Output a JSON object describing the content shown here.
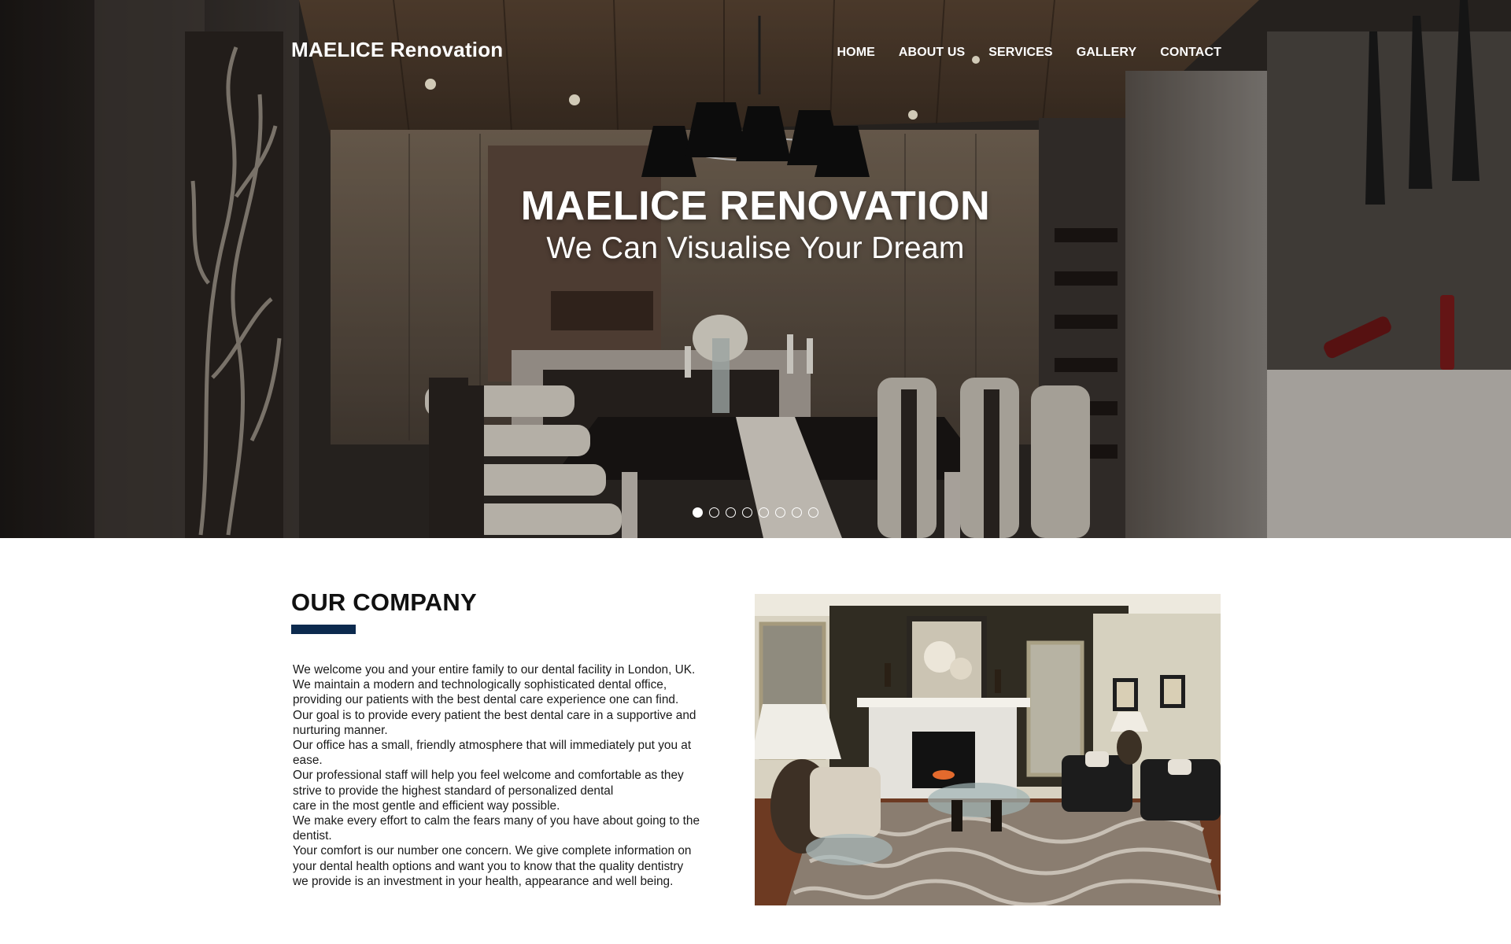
{
  "brand": "MAELICE Renovation",
  "nav": [
    "HOME",
    "ABOUT US",
    "SERVICES",
    "GALLERY",
    "CONTACT"
  ],
  "hero": {
    "title": "MAELICE RENOVATION",
    "subtitle": "We Can Visualise Your Dream",
    "slides_total": 8,
    "active_slide": 1
  },
  "company": {
    "title": "OUR COMPANY",
    "lines": [
      "We welcome you and your entire family to our dental facility in London, UK.",
      "We maintain a modern and technologically sophisticated dental office,",
      "providing our patients with the best dental care experience one can find.",
      "Our goal is to provide every patient the best dental care in a supportive and",
      "nurturing manner.",
      "Our office has a small, friendly atmosphere that will immediately put you at",
      "ease.",
      "Our professional staff will help you feel welcome and comfortable as they",
      "strive to provide the highest standard of personalized dental",
      "care in the most gentle and efficient way possible.",
      "We make every effort to calm the fears many of you have about going to the",
      "dentist.",
      "Your comfort is our number one concern. We give complete information on",
      "your dental health options and want you to know  that the quality dentistry",
      "we provide is an investment in your health, appearance and well being."
    ]
  },
  "colors": {
    "accent": "#0c2a4e",
    "hero_text": "#ffffff"
  }
}
